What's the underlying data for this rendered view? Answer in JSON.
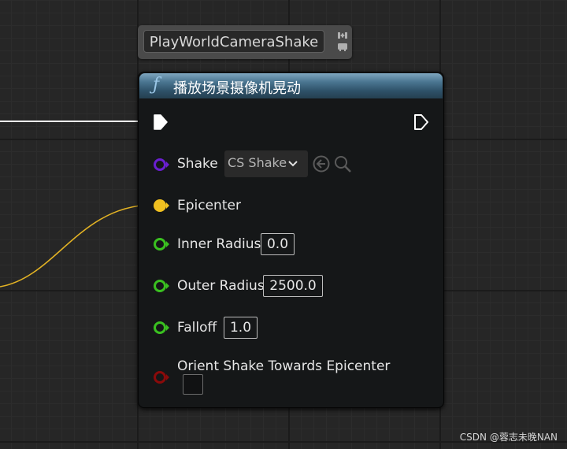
{
  "tooltip": {
    "label": "PlayWorldCameraShake"
  },
  "node": {
    "icon": "function-icon",
    "title": "播放场景摄像机晃动",
    "header_color": "#4a7590",
    "pins": {
      "shake": {
        "label": "Shake",
        "dropdown_value": "CS Shake",
        "color": "#6a1fd0"
      },
      "epicenter": {
        "label": "Epicenter",
        "color": "#f0c020"
      },
      "inner_radius": {
        "label": "Inner Radius",
        "value": "0.0",
        "color": "#3ac020"
      },
      "outer_radius": {
        "label": "Outer Radius",
        "value": "2500.0",
        "color": "#3ac020"
      },
      "falloff": {
        "label": "Falloff",
        "value": "1.0",
        "color": "#3ac020"
      },
      "orient": {
        "label": "Orient Shake Towards Epicenter",
        "color": "#8a0a0a",
        "checked": false
      }
    }
  },
  "wires": {
    "exec_color": "#ffffff",
    "vector_color": "#e0b020"
  },
  "watermark": "CSDN @蓉志未晚NAN"
}
